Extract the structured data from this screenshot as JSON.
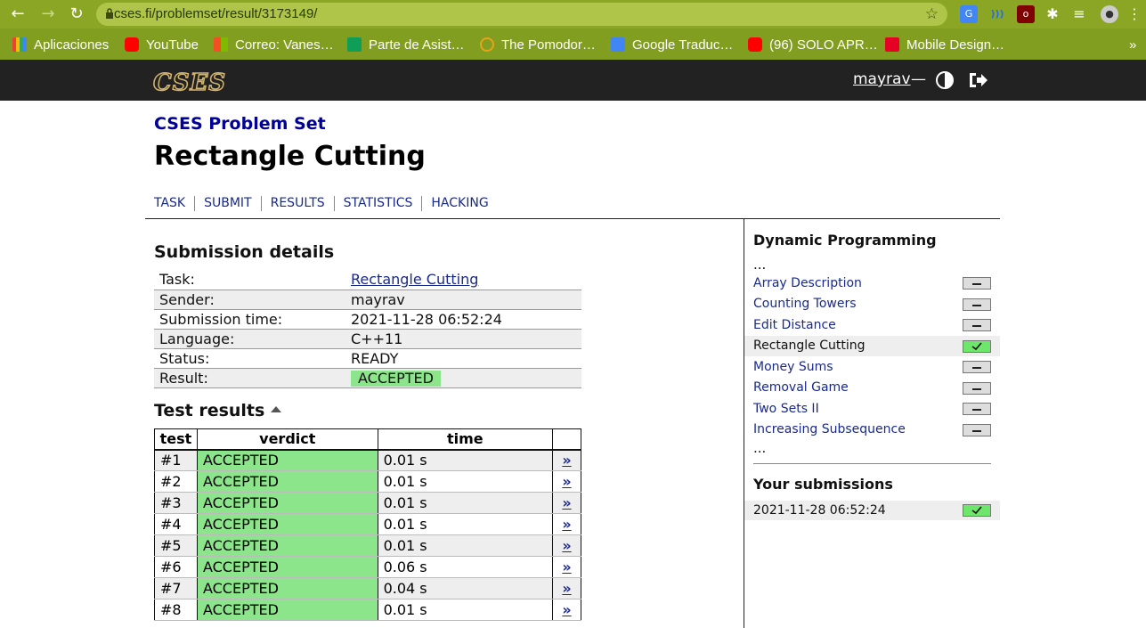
{
  "browser": {
    "url": "cses.fi/problemset/result/3173149/",
    "bookmarks": [
      {
        "label": "Aplicaciones",
        "icon": "apps-grid-icon",
        "color": "#ea4335"
      },
      {
        "label": "YouTube",
        "icon": "youtube-icon",
        "color": "#ff0000"
      },
      {
        "label": "Correo: Vanes…",
        "icon": "outlook-icon",
        "color": "#f25022"
      },
      {
        "label": "Parte de Asist…",
        "icon": "cross-icon",
        "color": "#109d58"
      },
      {
        "label": "The Pomodor…",
        "icon": "pomodoro-icon",
        "color": "#e8a317"
      },
      {
        "label": "Google Traduc…",
        "icon": "google-translate-icon",
        "color": "#4285f4"
      },
      {
        "label": "(96) SOLO APR…",
        "icon": "youtube-icon",
        "color": "#ff0000"
      },
      {
        "label": "Mobile Design…",
        "icon": "pinterest-icon",
        "color": "#e60023"
      }
    ],
    "more": "»"
  },
  "header": {
    "logo": "CSES",
    "username": "mayrav",
    "separator": "—"
  },
  "page": {
    "problemset": "CSES Problem Set",
    "title": "Rectangle Cutting",
    "nav": [
      "TASK",
      "SUBMIT",
      "RESULTS",
      "STATISTICS",
      "HACKING"
    ]
  },
  "details": {
    "heading": "Submission details",
    "rows": [
      {
        "key": "Task:",
        "value": "Rectangle Cutting"
      },
      {
        "key": "Sender:",
        "value": "mayrav"
      },
      {
        "key": "Submission time:",
        "value": "2021-11-28 06:52:24"
      },
      {
        "key": "Language:",
        "value": "C++11"
      },
      {
        "key": "Status:",
        "value": "READY"
      },
      {
        "key": "Result:",
        "value": "ACCEPTED"
      }
    ]
  },
  "tests": {
    "heading": "Test results",
    "headers": [
      "test",
      "verdict",
      "time",
      ""
    ],
    "link_glyph": "»",
    "rows": [
      {
        "test": "#1",
        "verdict": "ACCEPTED",
        "time": "0.01 s"
      },
      {
        "test": "#2",
        "verdict": "ACCEPTED",
        "time": "0.01 s"
      },
      {
        "test": "#3",
        "verdict": "ACCEPTED",
        "time": "0.01 s"
      },
      {
        "test": "#4",
        "verdict": "ACCEPTED",
        "time": "0.01 s"
      },
      {
        "test": "#5",
        "verdict": "ACCEPTED",
        "time": "0.01 s"
      },
      {
        "test": "#6",
        "verdict": "ACCEPTED",
        "time": "0.06 s"
      },
      {
        "test": "#7",
        "verdict": "ACCEPTED",
        "time": "0.04 s"
      },
      {
        "test": "#8",
        "verdict": "ACCEPTED",
        "time": "0.01 s"
      }
    ]
  },
  "sidebar": {
    "title": "Dynamic Programming",
    "ellipsis": "...",
    "items": [
      {
        "label": "Array Description",
        "status": "none"
      },
      {
        "label": "Counting Towers",
        "status": "none"
      },
      {
        "label": "Edit Distance",
        "status": "none"
      },
      {
        "label": "Rectangle Cutting",
        "status": "accepted",
        "current": true
      },
      {
        "label": "Money Sums",
        "status": "none"
      },
      {
        "label": "Removal Game",
        "status": "none"
      },
      {
        "label": "Two Sets II",
        "status": "none"
      },
      {
        "label": "Increasing Subsequence",
        "status": "none"
      }
    ],
    "submissions_title": "Your submissions",
    "submissions": [
      {
        "time": "2021-11-28 06:52:24",
        "status": "accepted"
      }
    ]
  },
  "colors": {
    "chrome": "#8aa624",
    "header": "#222222",
    "accepted": "#8de58b",
    "link": "#1a2a8a",
    "problemset": "#000099"
  }
}
